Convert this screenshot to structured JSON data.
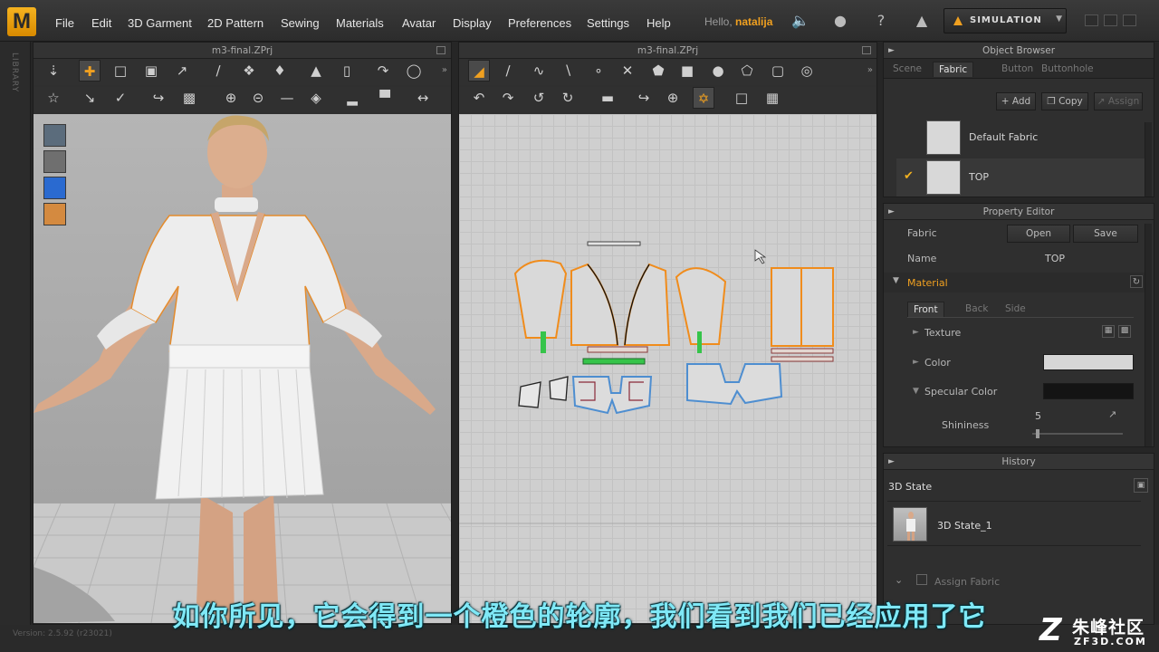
{
  "app": {
    "logo_letter": "M",
    "menu": [
      "File",
      "Edit",
      "3D Garment",
      "2D Pattern",
      "Sewing",
      "Materials",
      "Avatar",
      "Display",
      "Preferences",
      "Settings",
      "Help"
    ],
    "hello_prefix": "Hello,",
    "username": "natalija",
    "simulation_label": "SIMULATION",
    "accent_color": "#f0a020"
  },
  "library_label": "LIBRARY",
  "viewport3d": {
    "title": "m3-final.ZPrj",
    "toolbar_icons": [
      "move-down-icon",
      "transform-icon",
      "select-mesh-icon",
      "scale-icon",
      "pin-icon",
      "line-tool-icon",
      "brush-icon",
      "tack-icon",
      "shirt-icon",
      "pants-icon",
      "curve-icon",
      "ring-icon"
    ],
    "toolbar2_icons": [
      "avatar-pose-icon",
      "fold-icon",
      "stitch-icon",
      "seam-icon",
      "pattern-icon",
      "button-icon",
      "buttonhole-icon",
      "zipper-icon",
      "lock-icon",
      "steam-icon",
      "measure-icon",
      "arrow-icon"
    ],
    "side_buttons": [
      "garment-view-icon",
      "avatar-view-icon",
      "fabric-view-icon",
      "skin-view-icon"
    ]
  },
  "viewport2d": {
    "title": "m3-final.ZPrj",
    "toolbar_icons": [
      "transform-pattern-icon",
      "edit-point-icon",
      "edit-curve-icon",
      "add-point-icon",
      "curvature-icon",
      "cut-icon",
      "polygon-icon",
      "rectangle-icon",
      "circle-icon",
      "internal-polygon-icon",
      "internal-rect-icon",
      "internal-circle-icon"
    ],
    "toolbar2_icons": [
      "trace-icon",
      "offset-icon",
      "pleat-icon",
      "dart-icon",
      "iron-icon",
      "segment-sew-icon",
      "free-sew-icon",
      "check-sew-icon",
      "mirror-icon",
      "texture-icon"
    ]
  },
  "object_browser": {
    "title": "Object Browser",
    "tabs": [
      "Scene",
      "Fabric",
      "Button",
      "Buttonhole"
    ],
    "active_tab": "Fabric",
    "actions": [
      "Add",
      "Copy",
      "Assign"
    ],
    "fabrics": [
      {
        "name": "Default Fabric",
        "selected": false
      },
      {
        "name": "TOP",
        "selected": true
      }
    ]
  },
  "property_editor": {
    "title": "Property Editor",
    "fabric_label": "Fabric",
    "open_label": "Open",
    "save_label": "Save",
    "name_label": "Name",
    "name_value": "TOP",
    "material_label": "Material",
    "material_tabs": [
      "Front",
      "Back",
      "Side"
    ],
    "texture_label": "Texture",
    "color_label": "Color",
    "color_value": "#d6d6d6",
    "specular_label": "Specular Color",
    "specular_value": "#141414",
    "shininess_label": "Shininess",
    "shininess_value": "5"
  },
  "history": {
    "title": "History",
    "state_label": "3D State",
    "item": "3D State_1",
    "assign_fabric": "Assign Fabric"
  },
  "status": {
    "version": "Version: 2.5.92    (r23021)"
  },
  "subtitle": "如你所见，它会得到一个橙色的轮廓，我们看到我们已经应用了它",
  "watermark": {
    "cn": "朱峰社区",
    "en": "ZF3D.COM"
  }
}
